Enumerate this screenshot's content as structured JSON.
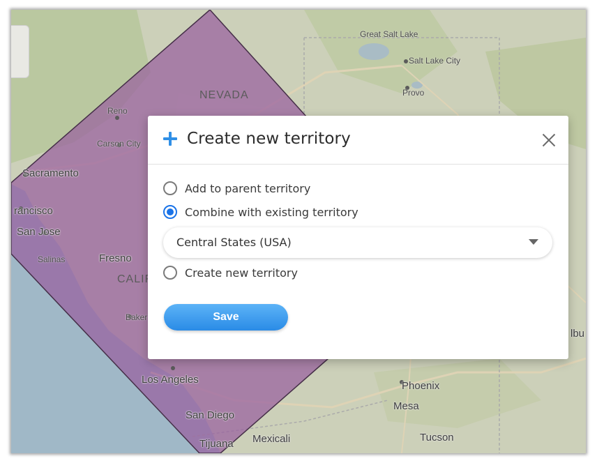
{
  "map": {
    "labels": {
      "nevada": "NEVADA",
      "great_salt_lake": "Great Salt Lake",
      "salt_lake_city": "Salt Lake City",
      "provo": "Provo",
      "reno": "Reno",
      "carson_city": "Carson City",
      "sacramento": "Sacramento",
      "san_francisco": "rancisco",
      "san_jose": "San Jose",
      "salinas": "Salinas",
      "fresno": "Fresno",
      "california": "CALIF",
      "bakersfield": "Baker",
      "los_angeles": "Los Angeles",
      "san_diego": "San Diego",
      "tijuana": "Tijuana",
      "mexicali": "Mexicali",
      "phoenix": "Phoenix",
      "mesa": "Mesa",
      "tucson": "Tucson",
      "albuquerque": "lbu"
    },
    "territory_color": "#a05aa8"
  },
  "modal": {
    "title": "Create new territory",
    "options": [
      {
        "label": "Add to parent territory",
        "checked": false
      },
      {
        "label": "Combine with existing territory",
        "checked": true
      },
      {
        "label": "Create new territory",
        "checked": false
      }
    ],
    "select": {
      "value": "Central States (USA)"
    },
    "save_label": "Save"
  },
  "colors": {
    "accent": "#1a73e8",
    "button": "#3d9af0"
  }
}
